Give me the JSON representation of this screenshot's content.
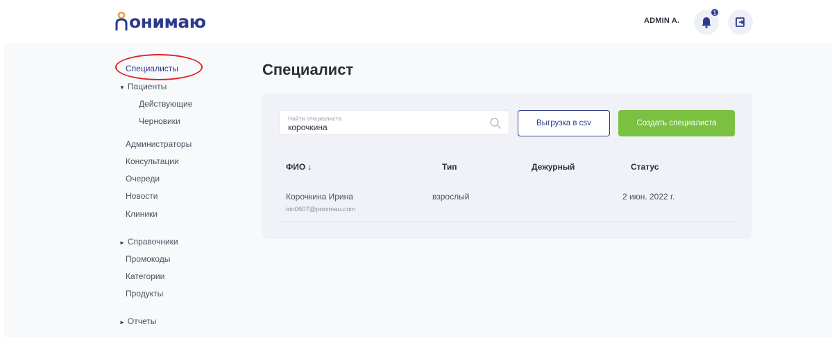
{
  "header": {
    "logo_text": "онимаю",
    "user_name": "ADMIN A.",
    "notification_count": "1"
  },
  "sidebar": {
    "items": [
      {
        "label": "Специалисты",
        "active": true
      },
      {
        "label": "Пациенты",
        "expandable": true,
        "expanded": true
      },
      {
        "label": "Действующие",
        "sub": true
      },
      {
        "label": "Черновики",
        "sub": true
      },
      {
        "label": "Администраторы"
      },
      {
        "label": "Консультации"
      },
      {
        "label": "Очереди"
      },
      {
        "label": "Новости"
      },
      {
        "label": "Клиники"
      },
      {
        "label": "Справочники",
        "expandable": true,
        "expanded": false
      },
      {
        "label": "Промокоды"
      },
      {
        "label": "Категории"
      },
      {
        "label": "Продукты"
      },
      {
        "label": "Отчеты",
        "expandable": true,
        "expanded": false
      }
    ]
  },
  "main": {
    "title": "Специалист",
    "search": {
      "label": "Найти специалиста",
      "value": "корочкина"
    },
    "export_button": "Выгрузка в csv",
    "create_button": "Создать специалиста",
    "table": {
      "columns": [
        "ФИО ↓",
        "Тип",
        "Дежурный",
        "Статус"
      ],
      "rows": [
        {
          "name": "Корочкина Ирина",
          "email": "irin0607@ponimau.com",
          "type": "взрослый",
          "duty": "",
          "status": "2 июн. 2022 г."
        }
      ]
    }
  },
  "colors": {
    "brand": "#2b3a8c",
    "accent_green": "#7ac142",
    "highlight": "#e02020"
  }
}
